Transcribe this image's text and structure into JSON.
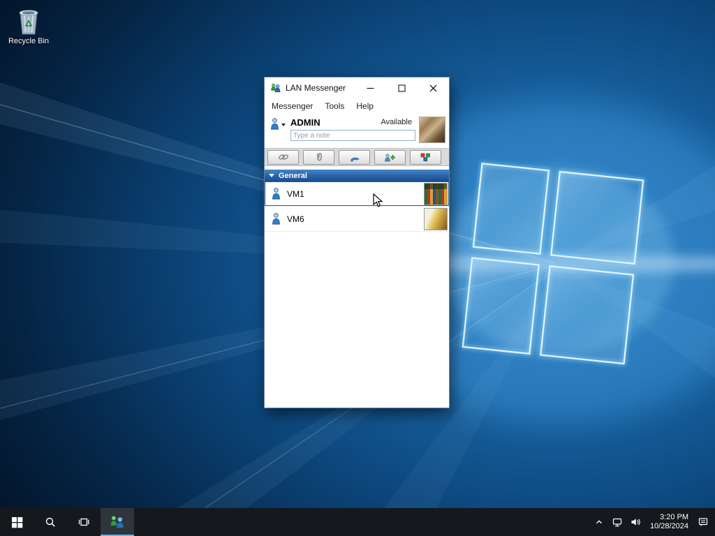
{
  "desktop": {
    "recycle_bin_label": "Recycle Bin"
  },
  "window": {
    "title": "LAN Messenger",
    "window_control_icons": [
      "minimize-icon",
      "maximize-icon",
      "close-icon"
    ],
    "menu_items": [
      "Messenger",
      "Tools",
      "Help"
    ],
    "user": {
      "name": "ADMIN",
      "status": "Available",
      "note_placeholder": "Type a note"
    },
    "toolbar_buttons": [
      {
        "icon": "link-icon"
      },
      {
        "icon": "paperclip-icon"
      },
      {
        "icon": "remote-connect-icon"
      },
      {
        "icon": "add-contact-icon"
      },
      {
        "icon": "blocks-icon"
      }
    ],
    "groups": [
      {
        "label": "General",
        "contacts": [
          {
            "name": "VM1"
          },
          {
            "name": "VM6"
          }
        ]
      }
    ]
  },
  "taskbar": {
    "left_icons": [
      "start-icon",
      "search-icon",
      "task-view-icon",
      "lan-messenger-icon"
    ],
    "tray_icons": [
      "hidden-icons-chevron",
      "network-icon",
      "volume-icon",
      "action-center-icon"
    ],
    "time": "3:20 PM",
    "date": "10/28/2024"
  },
  "colors": {
    "accent": "#2a6fb0",
    "group_header_top": "#4384ca",
    "group_header_bottom": "#174e8c",
    "taskbar_bg": "#15181c",
    "selection_border": "#2e5a94"
  }
}
